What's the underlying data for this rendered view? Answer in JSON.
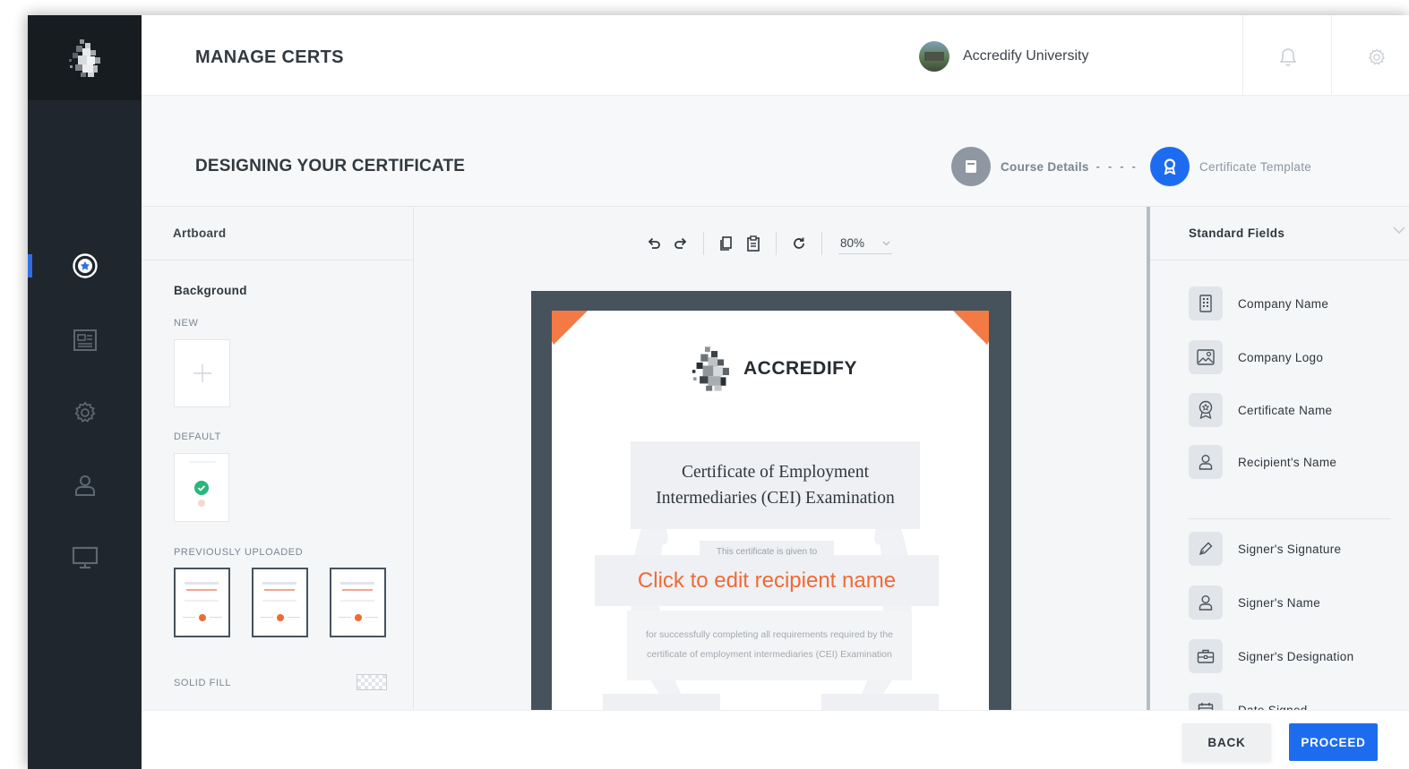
{
  "header": {
    "title": "MANAGE CERTS",
    "university": "Accredify University"
  },
  "design": {
    "title": "DESIGNING YOUR CERTIFICATE",
    "steps": [
      {
        "label": "Course Details",
        "state": "done",
        "icon": "book-icon"
      },
      {
        "label": "Certificate Template",
        "state": "active",
        "icon": "ribbon-icon"
      }
    ]
  },
  "artboard": {
    "header": "Artboard",
    "background_label": "Background",
    "new_label": "NEW",
    "default_label": "DEFAULT",
    "previously_uploaded_label": "PREVIOUSLY UPLOADED",
    "solid_fill_label": "SOLID FILL"
  },
  "toolbar": {
    "zoom": "80%"
  },
  "certificate": {
    "brand": "ACCREDIFY",
    "title_line1": "Certificate of Employment",
    "title_line2": "Intermediaries (CEI) Examination",
    "given_to": "This certificate is given to",
    "recipient_placeholder": "Click to edit recipient name",
    "description_line1": "for successfully completing all requirements required by the",
    "description_line2": "certificate of employment intermediaries (CEI) Examination"
  },
  "standard_fields": {
    "header": "Standard Fields",
    "items": [
      {
        "label": "Company Name",
        "icon": "building-icon"
      },
      {
        "label": "Company Logo",
        "icon": "image-icon"
      },
      {
        "label": "Certificate Name",
        "icon": "award-icon"
      },
      {
        "label": "Recipient's Name",
        "icon": "user-icon"
      },
      {
        "label": "Signer's Signature",
        "icon": "pen-icon"
      },
      {
        "label": "Signer's Name",
        "icon": "user-icon"
      },
      {
        "label": "Signer's Designation",
        "icon": "briefcase-icon"
      },
      {
        "label": "Date Signed",
        "icon": "calendar-icon"
      }
    ]
  },
  "footer": {
    "back_label": "BACK",
    "proceed_label": "PROCEED"
  },
  "colors": {
    "sidebar": "#1f262d",
    "accent": "#1d6cf0",
    "recipient": "#f06a35",
    "cert_frame": "#46525c"
  }
}
